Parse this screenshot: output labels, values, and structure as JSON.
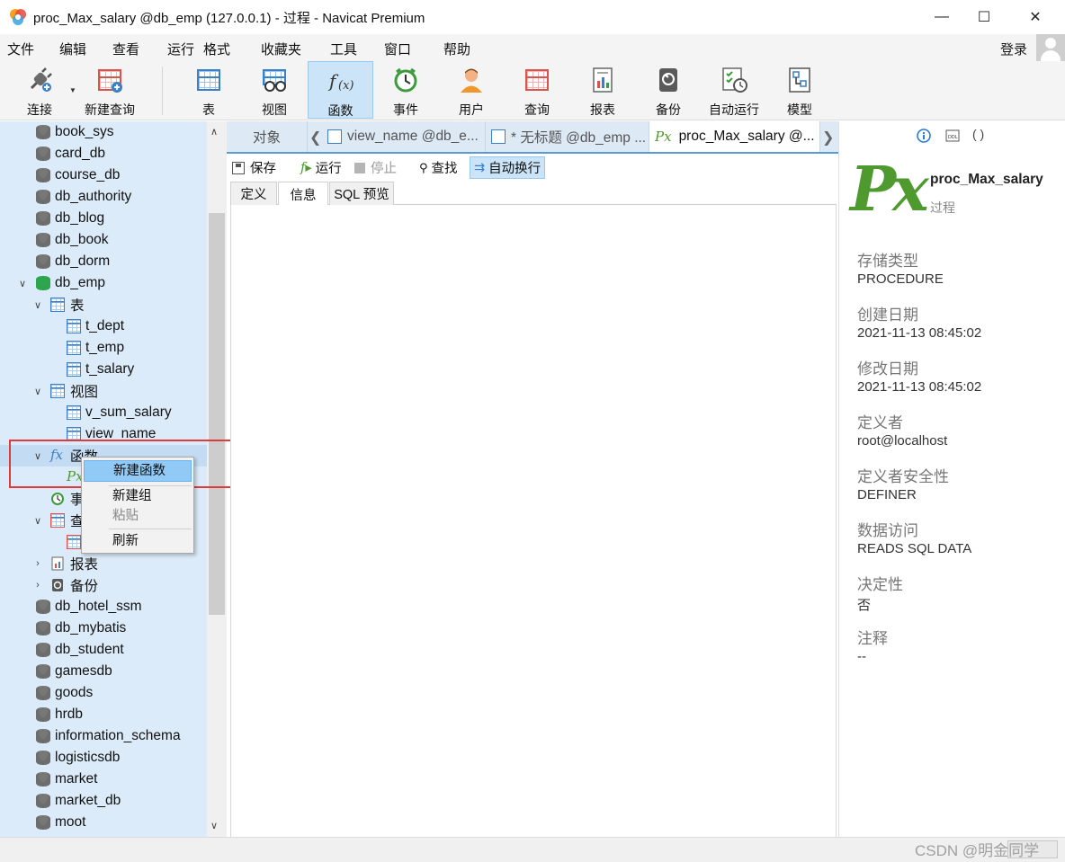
{
  "window": {
    "title": "proc_Max_salary @db_emp (127.0.0.1) - 过程 - Navicat Premium",
    "minimize": "—",
    "maximize": "☐",
    "close": "✕"
  },
  "menubar": {
    "items": [
      "文件",
      "编辑",
      "查看",
      "运行",
      "格式",
      "收藏夹",
      "工具",
      "窗口",
      "帮助"
    ],
    "login": "登录"
  },
  "toolbar": {
    "connect": "连接",
    "new_query": "新建查询",
    "buttons": [
      "表",
      "视图",
      "函数",
      "事件",
      "用户",
      "查询",
      "报表",
      "备份",
      "自动运行",
      "模型"
    ],
    "active": "函数"
  },
  "sidebar": {
    "items": [
      {
        "label": "book_sys"
      },
      {
        "label": "card_db"
      },
      {
        "label": "course_db"
      },
      {
        "label": "db_authority"
      },
      {
        "label": "db_blog"
      },
      {
        "label": "db_book"
      },
      {
        "label": "db_dorm"
      },
      {
        "label": "db_emp"
      },
      {
        "label": "表"
      },
      {
        "label": "t_dept"
      },
      {
        "label": "t_emp"
      },
      {
        "label": "t_salary"
      },
      {
        "label": "视图"
      },
      {
        "label": "v_sum_salary"
      },
      {
        "label": "view_name"
      },
      {
        "label": "函数"
      },
      {
        "label": "事"
      },
      {
        "label": "查"
      },
      {
        "label": "报表"
      },
      {
        "label": "备份"
      },
      {
        "label": "db_hotel_ssm"
      },
      {
        "label": "db_mybatis"
      },
      {
        "label": "db_student"
      },
      {
        "label": "gamesdb"
      },
      {
        "label": "goods"
      },
      {
        "label": "hrdb"
      },
      {
        "label": "information_schema"
      },
      {
        "label": "logisticsdb"
      },
      {
        "label": "market"
      },
      {
        "label": "market_db"
      },
      {
        "label": "moot"
      }
    ],
    "context_menu": {
      "items": [
        "新建函数",
        "新建组",
        "粘贴",
        "刷新"
      ]
    }
  },
  "tabs": {
    "objects": "对象",
    "tab1": "view_name @db_e...",
    "tab2": "* 无标题 @db_emp ...",
    "tab3": "proc_Max_salary @..."
  },
  "editor": {
    "save": "保存",
    "run": "运行",
    "stop": "停止",
    "find": "查找",
    "wrap": "自动换行",
    "subtabs": [
      "定义",
      "信息",
      "SQL 预览"
    ],
    "active_subtab": "信息"
  },
  "info": {
    "name": "proc_Max_salary",
    "type": "过程",
    "fields": [
      {
        "label": "存储类型",
        "value": "PROCEDURE"
      },
      {
        "label": "创建日期",
        "value": "2021-11-13 08:45:02"
      },
      {
        "label": "修改日期",
        "value": "2021-11-13 08:45:02"
      },
      {
        "label": "定义者",
        "value": "root@localhost"
      },
      {
        "label": "定义者安全性",
        "value": "DEFINER"
      },
      {
        "label": "数据访问",
        "value": "READS SQL DATA"
      },
      {
        "label": "决定性",
        "value": "否"
      },
      {
        "label": "注释",
        "value": "--"
      }
    ]
  },
  "statusbar": {
    "watermark": "CSDN @明金同学"
  },
  "colors": {
    "accent": "#5b9bd5",
    "sidebar_bg": "#dcebf9",
    "highlight_box": "#e03a3a",
    "function_green": "#4e9a2f"
  }
}
